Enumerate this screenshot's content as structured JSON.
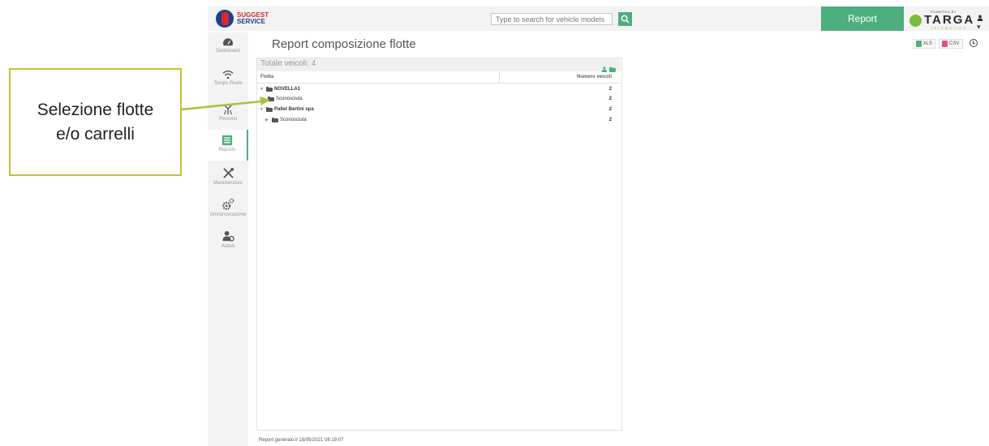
{
  "header": {
    "logo_line1": "SUGGEST",
    "logo_line2": "SERVICE",
    "search_placeholder": "Type to search for vehicle models",
    "report_label": "Report",
    "targa_powered": "POWERED BY",
    "targa_word": "TARGA",
    "targa_sub": "TELEMATICS",
    "user_caret": "▾"
  },
  "sidebar": {
    "items": [
      {
        "label": "Dashboard",
        "icon": "gauge-icon"
      },
      {
        "label": "Tempo Reale",
        "icon": "wifi-icon"
      },
      {
        "label": "Percorsi",
        "icon": "route-icon"
      },
      {
        "label": "Reports",
        "icon": "report-icon",
        "active": true
      },
      {
        "label": "Manutenzioni",
        "icon": "tools-icon"
      },
      {
        "label": "Amministrazione",
        "icon": "gears-icon"
      },
      {
        "label": "Autisti",
        "icon": "drivers-icon"
      }
    ]
  },
  "page": {
    "title": "Report composizione flotte",
    "xls_label": "XLS",
    "csv_label": "CSV"
  },
  "panel": {
    "total_label": "Totale veicoli: 4",
    "columns": {
      "flotta": "Flotta",
      "count": "Numero veicoli"
    },
    "rows": [
      {
        "label": "NOVELLA1",
        "count": "2",
        "level": 0,
        "expanded": true
      },
      {
        "label": "Sconosciuta",
        "count": "2",
        "level": 1
      },
      {
        "label": "Pallet Bertini spa",
        "count": "2",
        "level": 0,
        "expanded": true
      },
      {
        "label": "Sconosciuta",
        "count": "2",
        "level": 1,
        "collapsed": true
      }
    ]
  },
  "footer": {
    "generated": "Report generato il 18/05/2021 08:19:07"
  },
  "annotation": {
    "text": "Selezione flotte e/o carrelli"
  },
  "colors": {
    "accent": "#4caf7d",
    "callout_border": "#c4c23a",
    "arrow": "#a9c23a"
  }
}
